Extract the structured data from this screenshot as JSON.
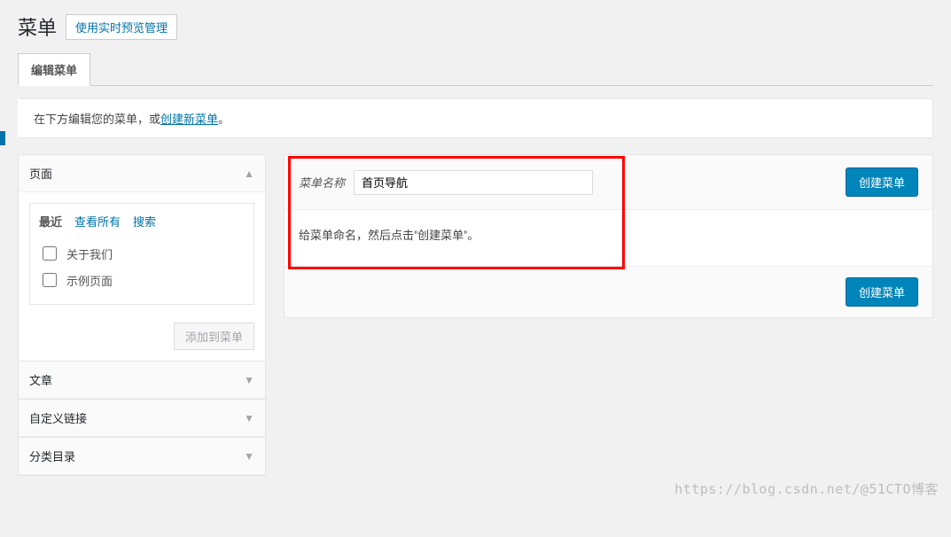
{
  "header": {
    "title": "菜单",
    "preview_button": "使用实时预览管理"
  },
  "tabs": {
    "edit": "编辑菜单"
  },
  "notice": {
    "prefix": "在下方编辑您的菜单，或",
    "link": "创建新菜单",
    "suffix": "。"
  },
  "sidebar": {
    "sections": {
      "pages": "页面",
      "posts": "文章",
      "links": "自定义链接",
      "categories": "分类目录"
    },
    "subtabs": {
      "recent": "最近",
      "all": "查看所有",
      "search": "搜索"
    },
    "page_items": [
      "关于我们",
      "示例页面"
    ],
    "add_button": "添加到菜单"
  },
  "main": {
    "name_label": "菜单名称",
    "name_value": "首页导航",
    "instruction": "给菜单命名，然后点击\"创建菜单\"。",
    "create_button": "创建菜单"
  },
  "watermark": "https://blog.csdn.net/@51CTO博客"
}
